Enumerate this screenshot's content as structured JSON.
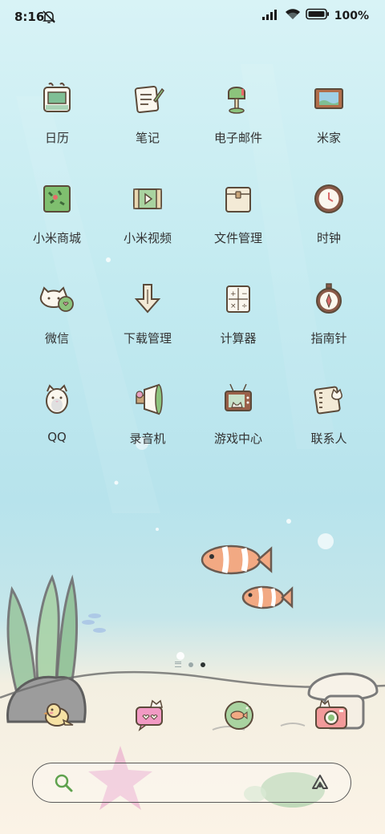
{
  "status_bar": {
    "time": "8:16",
    "battery": "100",
    "battery_unit": "%",
    "icons": [
      "bell-off-icon",
      "signal-icon",
      "wifi-icon",
      "battery-icon"
    ]
  },
  "apps": [
    {
      "label": "日历",
      "icon": "calendar-icon"
    },
    {
      "label": "笔记",
      "icon": "notes-icon"
    },
    {
      "label": "电子邮件",
      "icon": "mailbox-icon"
    },
    {
      "label": "米家",
      "icon": "picture-frame-icon"
    },
    {
      "label": "小米商城",
      "icon": "store-icon"
    },
    {
      "label": "小米视频",
      "icon": "video-icon"
    },
    {
      "label": "文件管理",
      "icon": "folder-icon"
    },
    {
      "label": "时钟",
      "icon": "clock-icon"
    },
    {
      "label": "微信",
      "icon": "wechat-cat-icon"
    },
    {
      "label": "下载管理",
      "icon": "download-arrow-icon"
    },
    {
      "label": "计算器",
      "icon": "calculator-icon"
    },
    {
      "label": "指南针",
      "icon": "compass-icon"
    },
    {
      "label": "QQ",
      "icon": "penguin-icon"
    },
    {
      "label": "录音机",
      "icon": "recorder-icon"
    },
    {
      "label": "游戏中心",
      "icon": "tv-cat-icon"
    },
    {
      "label": "联系人",
      "icon": "contacts-icon"
    }
  ],
  "page_indicator": {
    "pages": 3,
    "active": 3
  },
  "dock": [
    {
      "icon": "bird-phone-icon"
    },
    {
      "icon": "message-cat-icon"
    },
    {
      "icon": "browser-fish-icon"
    },
    {
      "icon": "camera-cat-icon"
    }
  ],
  "search_bar": {
    "left_icon": "search-icon",
    "right_icon": "assistant-icon"
  },
  "colors": {
    "accent_green": "#7cc06a",
    "outline": "#5b4a3a",
    "sky": "#c2eaf0",
    "sand": "#fbf3e6"
  }
}
